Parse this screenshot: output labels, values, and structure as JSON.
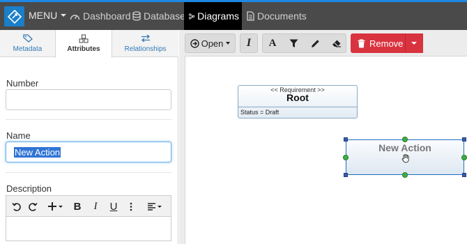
{
  "nav": {
    "menu_label": "MENU",
    "items": [
      {
        "label": "Dashboard",
        "icon": "dashboard-icon"
      },
      {
        "label": "Database",
        "icon": "database-icon"
      },
      {
        "label": "Diagrams",
        "icon": "diagrams-icon",
        "active": true
      },
      {
        "label": "Documents",
        "icon": "document-icon"
      }
    ],
    "colors": {
      "bar": "#4a4a4a",
      "active": "#000000",
      "accent": "#1e88e5"
    }
  },
  "left_panel": {
    "tabs": [
      {
        "label": "Metadata",
        "icon": "tag-icon"
      },
      {
        "label": "Attributes",
        "icon": "cubes-icon",
        "active": true
      },
      {
        "label": "Relationships",
        "icon": "exchange-icon"
      }
    ],
    "number": {
      "label": "Number",
      "value": ""
    },
    "name": {
      "label": "Name",
      "value": "New Action"
    },
    "description": {
      "label": "Description",
      "value": ""
    }
  },
  "toolbar": {
    "open_label": "Open",
    "remove_label": "Remove",
    "remove_color": "#d9333f"
  },
  "diagram": {
    "requirement": {
      "stereotype": "<< Requirement >>",
      "name": "Root",
      "status": "Status = Draft"
    },
    "action": {
      "name": "New Action"
    }
  }
}
